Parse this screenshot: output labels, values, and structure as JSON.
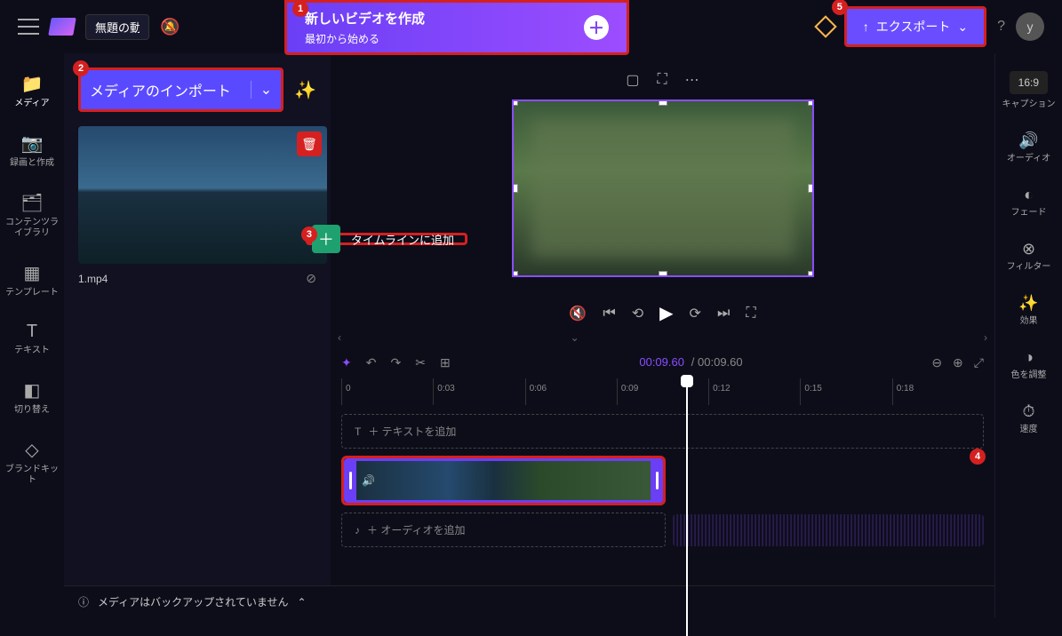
{
  "header": {
    "title_input": "無題の動",
    "banner_title": "新しいビデオを作成",
    "banner_subtitle": "最初から始める",
    "export_label": "エクスポート",
    "avatar_letter": "y"
  },
  "sidebar_left": {
    "items": [
      {
        "label": "メディア",
        "icon": "folder"
      },
      {
        "label": "録画と作成",
        "icon": "camera"
      },
      {
        "label": "コンテンツライブラリ",
        "icon": "library"
      },
      {
        "label": "テンプレート",
        "icon": "templates"
      },
      {
        "label": "テキスト",
        "icon": "text"
      },
      {
        "label": "切り替え",
        "icon": "transitions"
      },
      {
        "label": "ブランドキット",
        "icon": "brandkit"
      }
    ]
  },
  "media_panel": {
    "import_label": "メディアのインポート",
    "add_timeline_label": "タイムラインに追加",
    "file_name": "1.mp4"
  },
  "preview": {
    "aspect_label": "16:9"
  },
  "timeline": {
    "current_time": "00:09.60",
    "total_time": "00:09.60",
    "ticks": [
      "0",
      "0:03",
      "0:06",
      "0:09",
      "0:12",
      "0:15",
      "0:18"
    ],
    "text_hint": "＋ テキストを追加",
    "audio_hint": "＋ オーディオを追加"
  },
  "sidebar_right": {
    "items": [
      {
        "label": "キャプション",
        "icon": "cc"
      },
      {
        "label": "オーディオ",
        "icon": "speaker"
      },
      {
        "label": "フェード",
        "icon": "fade"
      },
      {
        "label": "フィルター",
        "icon": "filter"
      },
      {
        "label": "効果",
        "icon": "effects"
      },
      {
        "label": "色を調整",
        "icon": "color"
      },
      {
        "label": "速度",
        "icon": "speed"
      }
    ]
  },
  "footer": {
    "backup_warning": "メディアはバックアップされていません"
  },
  "annotations": {
    "n1": "1",
    "n2": "2",
    "n3": "3",
    "n4": "4",
    "n5": "5"
  }
}
